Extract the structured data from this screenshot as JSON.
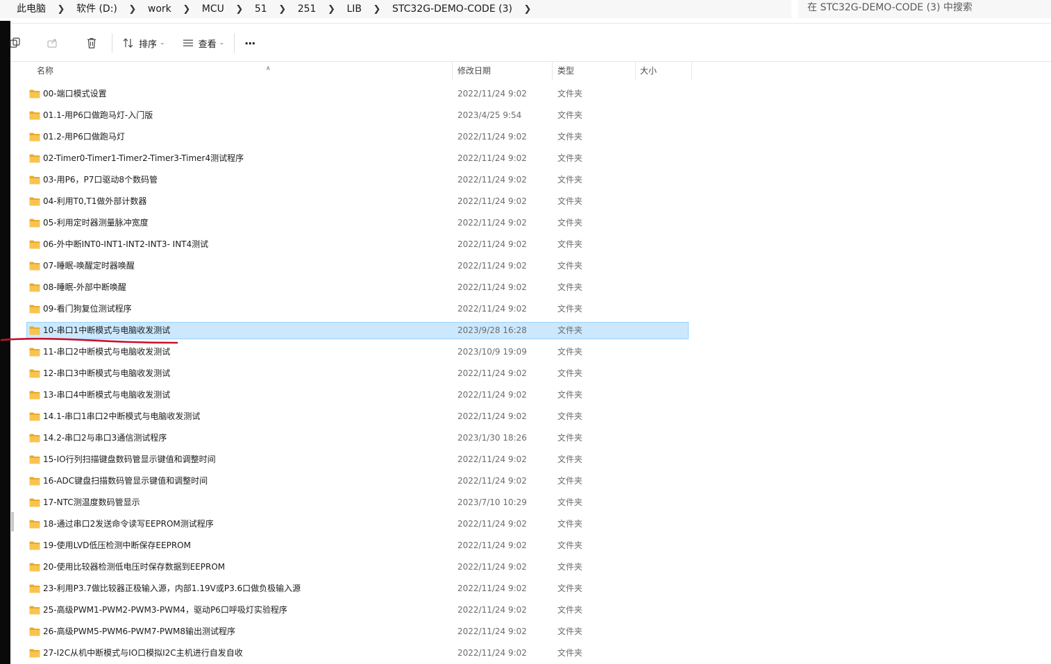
{
  "address": {
    "crumbs": [
      "此电脑",
      "软件 (D:)",
      "work",
      "MCU",
      "51",
      "251",
      "LIB",
      "STC32G-DEMO-CODE (3)"
    ],
    "search_placeholder": "在 STC32G-DEMO-CODE (3) 中搜索"
  },
  "toolbar": {
    "sort_label": "排序",
    "view_label": "查看",
    "more_label": "···",
    "icons": [
      "copy-icon",
      "share-icon",
      "delete-icon",
      "sort-icon",
      "view-icon",
      "more-icon"
    ]
  },
  "columns": {
    "name": "名称",
    "modified": "修改日期",
    "type": "类型",
    "size": "大小"
  },
  "selected_index": 11,
  "colors": {
    "selection_bg": "#cce8ff",
    "selection_border": "#99d1ff",
    "folder": "#f8c44f",
    "annotation": "#c8102e"
  },
  "files": [
    {
      "name": "00-端口模式设置",
      "date": "2022/11/24 9:02",
      "type": "文件夹"
    },
    {
      "name": "01.1-用P6口做跑马灯-入门版",
      "date": "2023/4/25 9:54",
      "type": "文件夹"
    },
    {
      "name": "01.2-用P6口做跑马灯",
      "date": "2022/11/24 9:02",
      "type": "文件夹"
    },
    {
      "name": "02-Timer0-Timer1-Timer2-Timer3-Timer4测试程序",
      "date": "2022/11/24 9:02",
      "type": "文件夹"
    },
    {
      "name": "03-用P6，P7口驱动8个数码管",
      "date": "2022/11/24 9:02",
      "type": "文件夹"
    },
    {
      "name": "04-利用T0,T1做外部计数器",
      "date": "2022/11/24 9:02",
      "type": "文件夹"
    },
    {
      "name": "05-利用定时器测量脉冲宽度",
      "date": "2022/11/24 9:02",
      "type": "文件夹"
    },
    {
      "name": "06-外中断INT0-INT1-INT2-INT3- INT4测试",
      "date": "2022/11/24 9:02",
      "type": "文件夹"
    },
    {
      "name": "07-睡眠-唤醒定时器唤醒",
      "date": "2022/11/24 9:02",
      "type": "文件夹"
    },
    {
      "name": "08-睡眠-外部中断唤醒",
      "date": "2022/11/24 9:02",
      "type": "文件夹"
    },
    {
      "name": "09-看门狗复位测试程序",
      "date": "2022/11/24 9:02",
      "type": "文件夹"
    },
    {
      "name": "10-串口1中断模式与电脑收发测试",
      "date": "2023/9/28 16:28",
      "type": "文件夹"
    },
    {
      "name": "11-串口2中断模式与电脑收发测试",
      "date": "2023/10/9 19:09",
      "type": "文件夹"
    },
    {
      "name": "12-串口3中断模式与电脑收发测试",
      "date": "2022/11/24 9:02",
      "type": "文件夹"
    },
    {
      "name": "13-串口4中断模式与电脑收发测试",
      "date": "2022/11/24 9:02",
      "type": "文件夹"
    },
    {
      "name": "14.1-串口1串口2中断模式与电脑收发测试",
      "date": "2022/11/24 9:02",
      "type": "文件夹"
    },
    {
      "name": "14.2-串口2与串口3通信测试程序",
      "date": "2023/1/30 18:26",
      "type": "文件夹"
    },
    {
      "name": "15-IO行列扫描键盘数码管显示键值和调整时间",
      "date": "2022/11/24 9:02",
      "type": "文件夹"
    },
    {
      "name": "16-ADC键盘扫描数码管显示键值和调整时间",
      "date": "2022/11/24 9:02",
      "type": "文件夹"
    },
    {
      "name": "17-NTC测温度数码管显示",
      "date": "2023/7/10 10:29",
      "type": "文件夹"
    },
    {
      "name": "18-通过串口2发送命令读写EEPROM测试程序",
      "date": "2022/11/24 9:02",
      "type": "文件夹"
    },
    {
      "name": "19-使用LVD低压检测中断保存EEPROM",
      "date": "2022/11/24 9:02",
      "type": "文件夹"
    },
    {
      "name": "20-使用比较器检测低电压时保存数据到EEPROM",
      "date": "2022/11/24 9:02",
      "type": "文件夹"
    },
    {
      "name": "23-利用P3.7做比较器正极输入源，内部1.19V或P3.6口做负极输入源",
      "date": "2022/11/24 9:02",
      "type": "文件夹"
    },
    {
      "name": "25-高级PWM1-PWM2-PWM3-PWM4，驱动P6口呼吸灯实验程序",
      "date": "2022/11/24 9:02",
      "type": "文件夹"
    },
    {
      "name": "26-高级PWM5-PWM6-PWM7-PWM8输出测试程序",
      "date": "2022/11/24 9:02",
      "type": "文件夹"
    },
    {
      "name": "27-I2C从机中断模式与IO口模拟I2C主机进行自发自收",
      "date": "2022/11/24 9:02",
      "type": "文件夹"
    }
  ]
}
